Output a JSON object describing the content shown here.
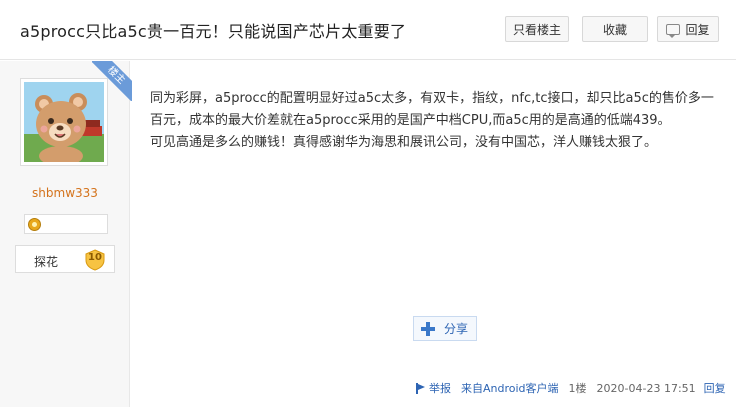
{
  "header": {
    "title": "a5procc只比a5c贵一百元！只能说国产芯片太重要了",
    "only_op_label": "只看楼主",
    "favorite_label": "收藏",
    "reply_label": "回复"
  },
  "author": {
    "badge": "楼主",
    "username": "shbmw333",
    "tanhua_label": "探花",
    "tanhua_level": "10"
  },
  "post": {
    "paragraphs": [
      "同为彩屏，a5procc的配置明显好过a5c太多，有双卡，指纹，nfc,tc接口，却只比a5c的售价多一百元，成本的最大价差就在a5procc采用的是国产中档CPU,而a5c用的是高通的低端439。",
      "可见高通是多么的赚钱！真得感谢华为海思和展讯公司，没有中国芯，洋人赚钱太狠了。"
    ],
    "share_label": "分享"
  },
  "footer": {
    "report_label": "举报",
    "source": "来自Android客户端",
    "floor": "1楼",
    "timestamp": "2020-04-23 17:51",
    "reply_label": "回复"
  },
  "colors": {
    "accent": "#2d64b3",
    "username": "#d4731c",
    "badge": "#6b9bd9"
  }
}
